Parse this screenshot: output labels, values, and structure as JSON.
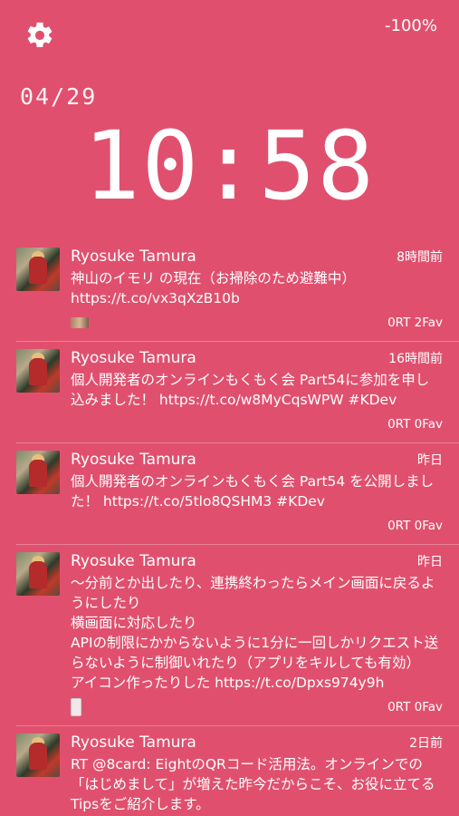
{
  "status": {
    "battery": "-100%"
  },
  "clock": {
    "date": "04/29",
    "time": "10:58"
  },
  "tweets": [
    {
      "name": "Ryosuke Tamura",
      "when": "8時間前",
      "text": "神山のイモリ の現在（お掃除のため避難中） https://t.co/vx3qXzB10b",
      "counts": "0RT 2Fav",
      "media": "photo-thumbnail"
    },
    {
      "name": "Ryosuke Tamura",
      "when": "16時間前",
      "text": "個人開発者のオンラインもくもく会 Part54に参加を申し込みました！ https://t.co/w8MyCqsWPW #KDev",
      "counts": "0RT 0Fav",
      "media": ""
    },
    {
      "name": "Ryosuke Tamura",
      "when": "昨日",
      "text": "個人開発者のオンラインもくもく会 Part54 を公開しました！ https://t.co/5tlo8QSHM3 #KDev",
      "counts": "0RT 0Fav",
      "media": ""
    },
    {
      "name": "Ryosuke Tamura",
      "when": "昨日",
      "text": "〜分前とか出したり、連携終わったらメイン画面に戻るようにしたり\n横画面に対応したり\nAPIの制限にかからないように1分に一回しかリクエスト送らないように制御いれたり（アプリをキルしても有効）\nアイコン作ったりした https://t.co/Dpxs974y9h",
      "counts": "0RT 0Fav",
      "media": "phone-thumbnail"
    },
    {
      "name": "Ryosuke Tamura",
      "when": "2日前",
      "text": "RT @8card: EightのQRコード活用法。オンラインでの「はじめまして」が増えた昨今だからこそ、お役に立てるTipsをご紹介します。",
      "counts": "",
      "media": ""
    }
  ]
}
